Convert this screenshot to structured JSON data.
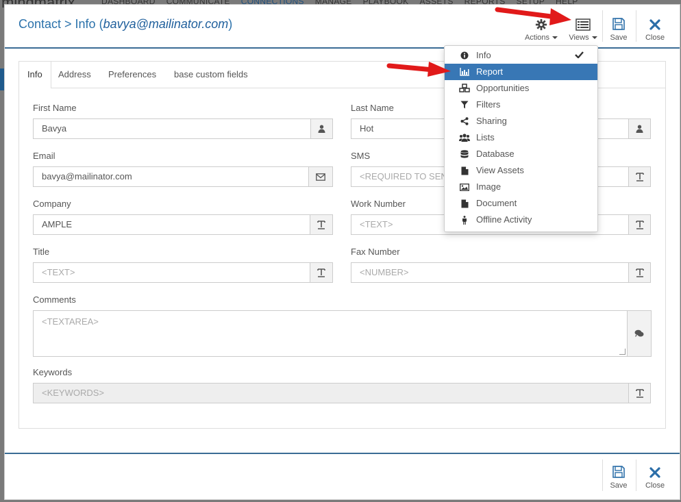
{
  "background": {
    "logo": "mindmatrix",
    "nav": [
      "DASHBOARD",
      "COMMUNICATE",
      "CONNECTIONS",
      "MANAGE",
      "PLAYBOOK",
      "ASSETS",
      "REPORTS",
      "SETUP",
      "HELP"
    ]
  },
  "header": {
    "title_prefix": "Contact > Info (",
    "title_email": "bavya@mailinator.com",
    "title_suffix": ")",
    "actions_label": "Actions",
    "views_label": "Views",
    "save_label": "Save",
    "close_label": "Close"
  },
  "tabs": [
    "Info",
    "Address",
    "Preferences",
    "base custom fields"
  ],
  "form": {
    "first_name": {
      "label": "First Name",
      "value": "Bavya"
    },
    "last_name": {
      "label": "Last Name",
      "value": "Hot"
    },
    "email": {
      "label": "Email",
      "value": "bavya@mailinator.com"
    },
    "sms": {
      "label": "SMS",
      "placeholder": "<REQUIRED TO SEND"
    },
    "company": {
      "label": "Company",
      "value": "AMPLE"
    },
    "work_number": {
      "label": "Work Number",
      "placeholder": "<TEXT>"
    },
    "title": {
      "label": "Title",
      "placeholder": "<TEXT>"
    },
    "fax_number": {
      "label": "Fax Number",
      "placeholder": "<NUMBER>"
    },
    "comments": {
      "label": "Comments",
      "placeholder": "<TEXTAREA>"
    },
    "keywords": {
      "label": "Keywords",
      "placeholder": "<KEYWORDS>"
    }
  },
  "views_menu": {
    "items": [
      {
        "label": "Info",
        "icon": "info-circle-icon",
        "checked": true
      },
      {
        "label": "Report",
        "icon": "bar-chart-icon",
        "selected": true
      },
      {
        "label": "Opportunities",
        "icon": "cubes-icon"
      },
      {
        "label": "Filters",
        "icon": "filter-icon"
      },
      {
        "label": "Sharing",
        "icon": "share-icon"
      },
      {
        "label": "Lists",
        "icon": "users-icon"
      },
      {
        "label": "Database",
        "icon": "database-icon"
      },
      {
        "label": "View Assets",
        "icon": "file-icon"
      },
      {
        "label": "Image",
        "icon": "image-icon"
      },
      {
        "label": "Document",
        "icon": "file-icon"
      },
      {
        "label": "Offline Activity",
        "icon": "person-icon"
      }
    ]
  },
  "footer": {
    "save_label": "Save",
    "close_label": "Close"
  },
  "colors": {
    "accent": "#2b72ab",
    "selected_menu": "#3877b5",
    "annotation_arrow": "#e11a1a"
  }
}
